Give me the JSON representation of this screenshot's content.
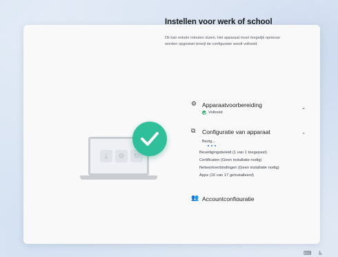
{
  "dialog": {
    "title": "Instellen voor werk of school",
    "description": "Dit kan enkele minuten duren. Het apparaat moet mogelijk opnieuw worden opgestart terwijl de configuratie wordt voltooid."
  },
  "steps": [
    {
      "title": "Apparaatvoorbereiding",
      "status": "Voltooid",
      "icon": "gear-icon",
      "expanded": false
    },
    {
      "title": "Configuratie van apparaat",
      "status": "Bezig...",
      "icon": "device-config-icon",
      "expanded": true,
      "items": [
        "Beveiligingsbeleid (1 van 1 toegepast)",
        "Certificaten (Geen installatie nodig)",
        "Netwerkverbindingen (Geen installatie nodig)",
        "Apps (16 van 17 geïnstalleerd)"
      ]
    },
    {
      "title": "Accountconfiguratie",
      "icon": "people-icon"
    }
  ],
  "colors": {
    "accent_green": "#2fbf9a",
    "status_green": "#2fa86b",
    "progress_blue": "#2a6fd6"
  }
}
